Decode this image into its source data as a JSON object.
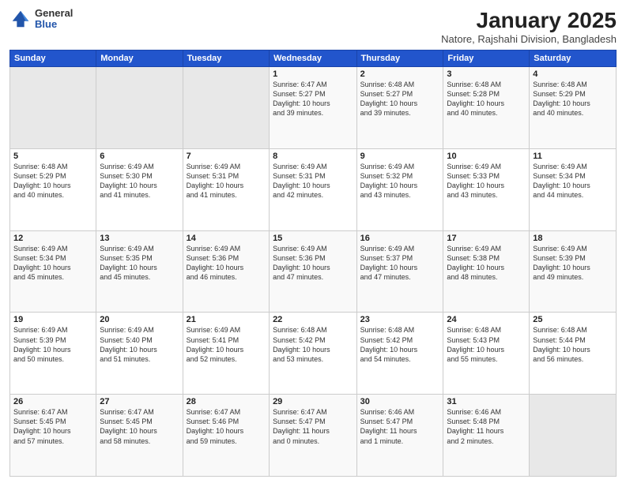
{
  "logo": {
    "general": "General",
    "blue": "Blue"
  },
  "title": "January 2025",
  "location": "Natore, Rajshahi Division, Bangladesh",
  "days_of_week": [
    "Sunday",
    "Monday",
    "Tuesday",
    "Wednesday",
    "Thursday",
    "Friday",
    "Saturday"
  ],
  "weeks": [
    [
      {
        "day": "",
        "info": ""
      },
      {
        "day": "",
        "info": ""
      },
      {
        "day": "",
        "info": ""
      },
      {
        "day": "1",
        "info": "Sunrise: 6:47 AM\nSunset: 5:27 PM\nDaylight: 10 hours\nand 39 minutes."
      },
      {
        "day": "2",
        "info": "Sunrise: 6:48 AM\nSunset: 5:27 PM\nDaylight: 10 hours\nand 39 minutes."
      },
      {
        "day": "3",
        "info": "Sunrise: 6:48 AM\nSunset: 5:28 PM\nDaylight: 10 hours\nand 40 minutes."
      },
      {
        "day": "4",
        "info": "Sunrise: 6:48 AM\nSunset: 5:29 PM\nDaylight: 10 hours\nand 40 minutes."
      }
    ],
    [
      {
        "day": "5",
        "info": "Sunrise: 6:48 AM\nSunset: 5:29 PM\nDaylight: 10 hours\nand 40 minutes."
      },
      {
        "day": "6",
        "info": "Sunrise: 6:49 AM\nSunset: 5:30 PM\nDaylight: 10 hours\nand 41 minutes."
      },
      {
        "day": "7",
        "info": "Sunrise: 6:49 AM\nSunset: 5:31 PM\nDaylight: 10 hours\nand 41 minutes."
      },
      {
        "day": "8",
        "info": "Sunrise: 6:49 AM\nSunset: 5:31 PM\nDaylight: 10 hours\nand 42 minutes."
      },
      {
        "day": "9",
        "info": "Sunrise: 6:49 AM\nSunset: 5:32 PM\nDaylight: 10 hours\nand 43 minutes."
      },
      {
        "day": "10",
        "info": "Sunrise: 6:49 AM\nSunset: 5:33 PM\nDaylight: 10 hours\nand 43 minutes."
      },
      {
        "day": "11",
        "info": "Sunrise: 6:49 AM\nSunset: 5:34 PM\nDaylight: 10 hours\nand 44 minutes."
      }
    ],
    [
      {
        "day": "12",
        "info": "Sunrise: 6:49 AM\nSunset: 5:34 PM\nDaylight: 10 hours\nand 45 minutes."
      },
      {
        "day": "13",
        "info": "Sunrise: 6:49 AM\nSunset: 5:35 PM\nDaylight: 10 hours\nand 45 minutes."
      },
      {
        "day": "14",
        "info": "Sunrise: 6:49 AM\nSunset: 5:36 PM\nDaylight: 10 hours\nand 46 minutes."
      },
      {
        "day": "15",
        "info": "Sunrise: 6:49 AM\nSunset: 5:36 PM\nDaylight: 10 hours\nand 47 minutes."
      },
      {
        "day": "16",
        "info": "Sunrise: 6:49 AM\nSunset: 5:37 PM\nDaylight: 10 hours\nand 47 minutes."
      },
      {
        "day": "17",
        "info": "Sunrise: 6:49 AM\nSunset: 5:38 PM\nDaylight: 10 hours\nand 48 minutes."
      },
      {
        "day": "18",
        "info": "Sunrise: 6:49 AM\nSunset: 5:39 PM\nDaylight: 10 hours\nand 49 minutes."
      }
    ],
    [
      {
        "day": "19",
        "info": "Sunrise: 6:49 AM\nSunset: 5:39 PM\nDaylight: 10 hours\nand 50 minutes."
      },
      {
        "day": "20",
        "info": "Sunrise: 6:49 AM\nSunset: 5:40 PM\nDaylight: 10 hours\nand 51 minutes."
      },
      {
        "day": "21",
        "info": "Sunrise: 6:49 AM\nSunset: 5:41 PM\nDaylight: 10 hours\nand 52 minutes."
      },
      {
        "day": "22",
        "info": "Sunrise: 6:48 AM\nSunset: 5:42 PM\nDaylight: 10 hours\nand 53 minutes."
      },
      {
        "day": "23",
        "info": "Sunrise: 6:48 AM\nSunset: 5:42 PM\nDaylight: 10 hours\nand 54 minutes."
      },
      {
        "day": "24",
        "info": "Sunrise: 6:48 AM\nSunset: 5:43 PM\nDaylight: 10 hours\nand 55 minutes."
      },
      {
        "day": "25",
        "info": "Sunrise: 6:48 AM\nSunset: 5:44 PM\nDaylight: 10 hours\nand 56 minutes."
      }
    ],
    [
      {
        "day": "26",
        "info": "Sunrise: 6:47 AM\nSunset: 5:45 PM\nDaylight: 10 hours\nand 57 minutes."
      },
      {
        "day": "27",
        "info": "Sunrise: 6:47 AM\nSunset: 5:45 PM\nDaylight: 10 hours\nand 58 minutes."
      },
      {
        "day": "28",
        "info": "Sunrise: 6:47 AM\nSunset: 5:46 PM\nDaylight: 10 hours\nand 59 minutes."
      },
      {
        "day": "29",
        "info": "Sunrise: 6:47 AM\nSunset: 5:47 PM\nDaylight: 11 hours\nand 0 minutes."
      },
      {
        "day": "30",
        "info": "Sunrise: 6:46 AM\nSunset: 5:47 PM\nDaylight: 11 hours\nand 1 minute."
      },
      {
        "day": "31",
        "info": "Sunrise: 6:46 AM\nSunset: 5:48 PM\nDaylight: 11 hours\nand 2 minutes."
      },
      {
        "day": "",
        "info": ""
      }
    ]
  ]
}
